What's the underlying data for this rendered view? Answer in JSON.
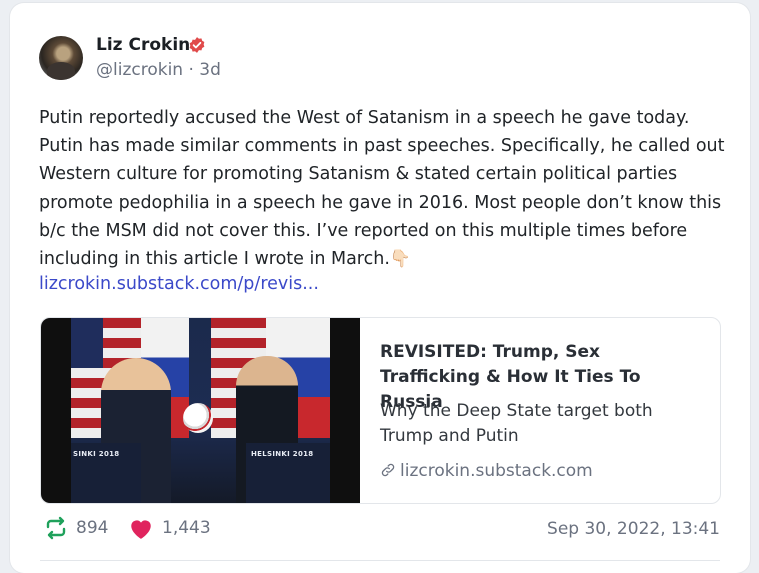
{
  "post": {
    "author_name": "Liz Crokin",
    "handle": "@lizcrokin",
    "separator": "·",
    "age": "3d",
    "body": "Putin reportedly accused the West of Satanism in a speech he gave today. Putin has made similar comments in past speeches. Specifically, he called out Western culture for promoting Satanism & stated certain political parties promote pedophilia in a speech he gave in 2016. Most people don’t know this b/c the MSM did not cover this. I’ve reported on this multiple times before including in this article I wrote in March.",
    "emoji": "👇🏻",
    "link_text": "lizcrokin.substack.com/p/revis...",
    "verified_icon": "verified-badge-icon"
  },
  "preview": {
    "title": "REVISITED: Trump, Sex Trafficking & How It Ties To Russia",
    "description": "Why the Deep State target both Trump and Putin",
    "domain": "lizcrokin.substack.com",
    "image_podium_left": "SINKI 2018",
    "image_podium_right": "HELSINKI 2018"
  },
  "stats": {
    "reposts": "894",
    "likes": "1,443",
    "timestamp": "Sep 30, 2022, 13:41"
  },
  "colors": {
    "link": "#3b49c9",
    "repost_icon": "#1fa15b",
    "like_icon": "#e0245e",
    "verified": "#e04a4a"
  }
}
